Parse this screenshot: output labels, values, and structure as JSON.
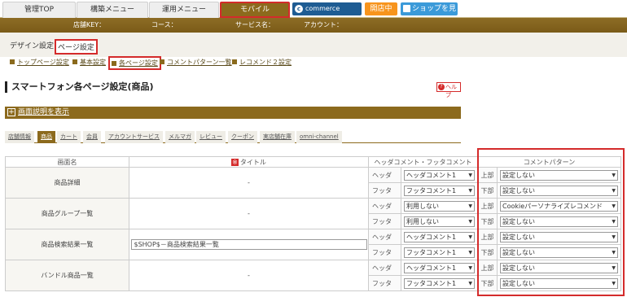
{
  "topnav": {
    "tabs": [
      {
        "label": "管理TOP"
      },
      {
        "label": "構築メニュー"
      },
      {
        "label": "運用メニュー"
      },
      {
        "label": "モバイル"
      }
    ],
    "brand": "commerce creator",
    "shop_status": "開店中",
    "view_shop": "ショップを見る"
  },
  "infobar": {
    "shop_key_label": "店舗KEY：",
    "course_label": "コース：",
    "service_label": "サービス名：",
    "account_label": "アカウント："
  },
  "subnav": {
    "design": "デザイン設定",
    "page": "ページ設定"
  },
  "breadcrumbs": [
    "トップページ設定",
    "基本設定",
    "各ページ設定",
    "コメントパターン一覧",
    "レコメンド２設定"
  ],
  "page_title": "スマートフォン各ページ設定(商品)",
  "help_label": "ヘルプ",
  "description_toggle": "画面説明を表示",
  "page_tabs": [
    "店舗情報",
    "商品",
    "カート",
    "会員",
    "アカウントサービス",
    "メルマガ",
    "レビュー",
    "クーポン",
    "実店舗在庫",
    "omni-channel"
  ],
  "table": {
    "headers": {
      "screen": "画面名",
      "title": "タイトル",
      "header_footer": "ヘッダコメント・フッタコメント",
      "pattern": "コメントパターン"
    },
    "labels": {
      "header": "ヘッダ",
      "footer": "フッタ",
      "top": "上部",
      "bottom": "下部"
    },
    "rows": [
      {
        "name": "商品詳細",
        "title": "-",
        "header_sel": "ヘッダコメント1",
        "footer_sel": "フッタコメント1",
        "top_sel": "設定しない",
        "bottom_sel": "設定しない"
      },
      {
        "name": "商品グループ一覧",
        "title": "-",
        "header_sel": "利用しない",
        "footer_sel": "利用しない",
        "top_sel": "Cookieパーソナライズレコメンド",
        "bottom_sel": "設定しない"
      },
      {
        "name": "商品検索結果一覧",
        "title": "$SHOP$－商品検索結果一覧",
        "header_sel": "ヘッダコメント1",
        "footer_sel": "フッタコメント1",
        "top_sel": "設定しない",
        "bottom_sel": "設定しない"
      },
      {
        "name": "バンドル商品一覧",
        "title": "-",
        "header_sel": "ヘッダコメント1",
        "footer_sel": "フッタコメント1",
        "top_sel": "設定しない",
        "bottom_sel": "設定しない"
      }
    ]
  },
  "colors": {
    "accent": "#8c6a1d",
    "highlight": "#d42b2b",
    "brand": "#1e5c93",
    "open": "#f7941d"
  }
}
